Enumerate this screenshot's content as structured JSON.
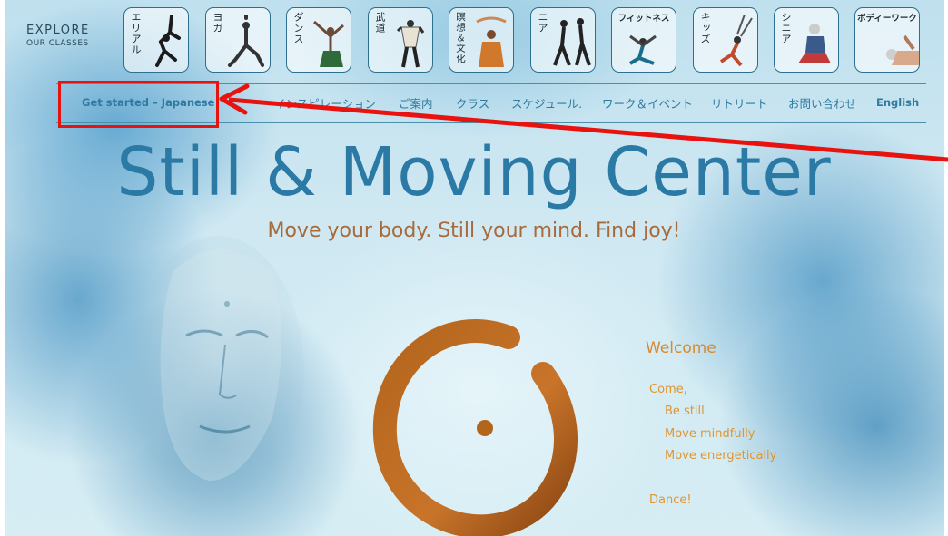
{
  "explore": {
    "line1": "EXPLORE",
    "line2": "OUR CLASSES"
  },
  "classes": [
    {
      "label": "エリアル",
      "icon": "aerial-silhouette-icon"
    },
    {
      "label": "ヨガ",
      "icon": "yoga-silhouette-icon"
    },
    {
      "label": "ダンス",
      "icon": "dance-silhouette-icon"
    },
    {
      "label": "武道",
      "icon": "martial-arts-silhouette-icon"
    },
    {
      "label": "瞑想＆文化",
      "icon": "meditation-silhouette-icon"
    },
    {
      "label": "ニア",
      "icon": "nia-silhouette-icon"
    },
    {
      "label": "フィットネス",
      "icon": "fitness-silhouette-icon"
    },
    {
      "label": "キッズ",
      "icon": "kids-silhouette-icon"
    },
    {
      "label": "シニア",
      "icon": "senior-silhouette-icon"
    },
    {
      "label": "ボディーワーク",
      "icon": "bodywork-silhouette-icon"
    }
  ],
  "nav": [
    "Get started – Japanese",
    "インスピレーション",
    "ご案内",
    "クラス",
    "スケジュール.",
    "ワーク＆イベント",
    "リトリート",
    "お問い合わせ",
    "English"
  ],
  "title": "Still & Moving Center",
  "tagline": "Move your body. Still your mind. Find joy!",
  "welcome": {
    "title": "Welcome",
    "lines": [
      "Come,",
      "Be still",
      "Move mindfully",
      "Move energetically",
      "Dance!"
    ]
  },
  "colors": {
    "nav_link": "#2f7aa0",
    "title": "#2b7aa6",
    "tagline": "#a86a3a",
    "welcome": "#e0952e",
    "annotation": "#e8120f"
  }
}
